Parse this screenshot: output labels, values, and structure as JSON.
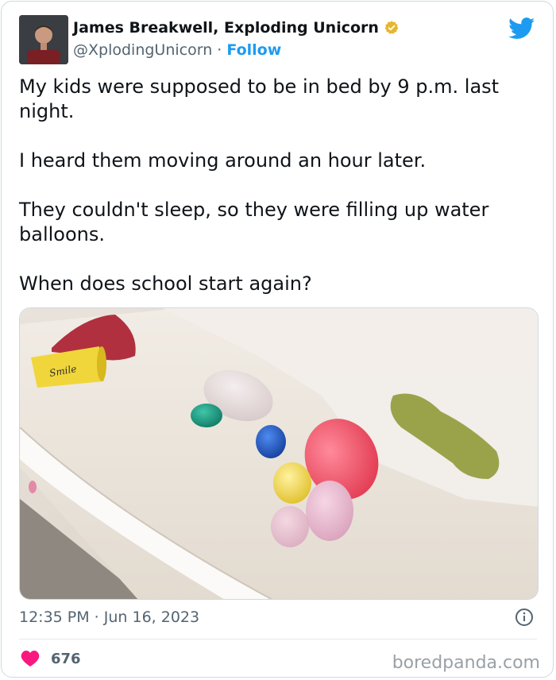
{
  "author": {
    "name": "James Breakwell, Exploding Unicorn",
    "handle": "@XplodingUnicorn",
    "separator": " · ",
    "follow_label": "Follow"
  },
  "tweet": {
    "paragraphs": [
      "My kids were supposed to be in bed by 9 p.m. last night.",
      "I heard them moving around an hour later.",
      "They couldn't sleep, so they were filling up water balloons.",
      "When does school start again?"
    ],
    "cup_text": "Smile"
  },
  "meta": {
    "timestamp": "12:35 PM · Jun 16, 2023"
  },
  "engagement": {
    "likes": "676"
  },
  "watermark": "boredpanda.com",
  "colors": {
    "accent": "#1d9bf0",
    "heart": "#f91880",
    "verified_gold": "#e8b52c",
    "secondary_text": "#536471"
  },
  "icons": {
    "brand": "twitter-bird-icon",
    "verified": "verified-badge-icon",
    "info": "info-icon",
    "like": "heart-icon"
  }
}
